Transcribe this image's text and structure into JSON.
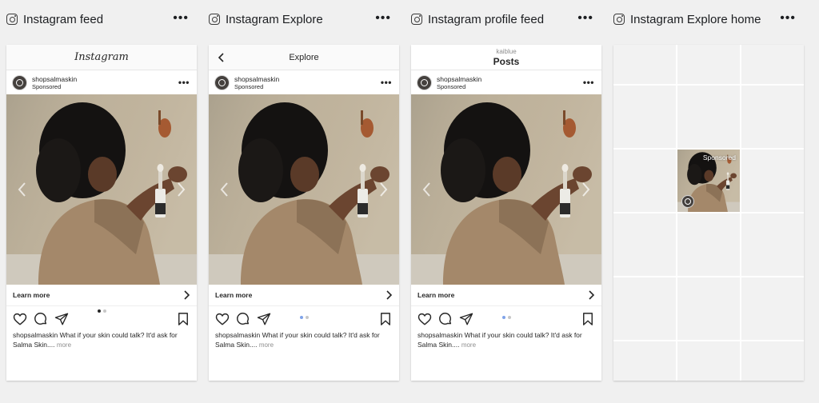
{
  "colors": {
    "page_bg": "#f0f0f0",
    "dot_active_dark": "#262626",
    "dot_active_blue": "#7fa3e8",
    "text": "#262626",
    "muted": "#8e8e8e"
  },
  "columns": [
    {
      "icon": "instagram-icon",
      "title": "Instagram feed"
    },
    {
      "icon": "instagram-icon",
      "title": "Instagram Explore"
    },
    {
      "icon": "instagram-icon",
      "title": "Instagram profile feed"
    },
    {
      "icon": "instagram-icon",
      "title": "Instagram Explore home"
    }
  ],
  "feed": {
    "brand": "Instagram"
  },
  "explore": {
    "title": "Explore"
  },
  "profile": {
    "username": "kaiblue",
    "title": "Posts"
  },
  "post": {
    "username": "shopsalmaskin",
    "sponsored": "Sponsored",
    "cta": "Learn more",
    "caption_user": "shopsalmaskin",
    "caption_text": "What if your skin could talk? It'd ask for Salma Skin....",
    "caption_more": "more"
  },
  "explore_home": {
    "tile_label": "Sponsored"
  },
  "icons": {
    "more": "more-horizontal-icon",
    "like": "heart-icon",
    "comment": "comment-icon",
    "share": "send-icon",
    "save": "bookmark-icon",
    "back": "chevron-left-icon",
    "cta": "chevron-right-icon"
  },
  "carousel": {
    "slides": 2,
    "active": 1
  }
}
